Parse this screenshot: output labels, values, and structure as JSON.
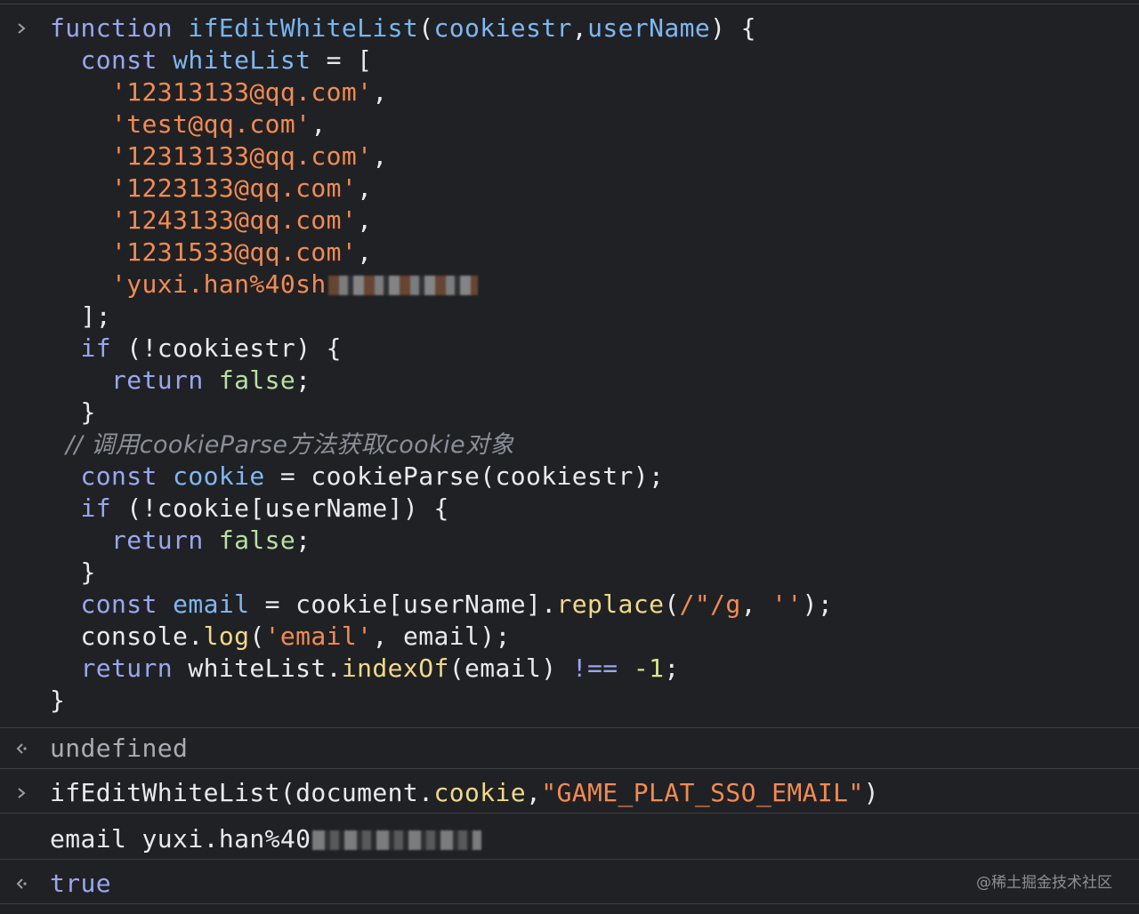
{
  "console": {
    "input1": {
      "lines": [
        [
          "function ",
          "ifEditWhiteList",
          "(",
          "cookiestr",
          ",",
          "userName",
          ") {"
        ],
        [
          "  const ",
          "whiteList",
          " = ["
        ],
        [
          "    ",
          "'12313133@qq.com'",
          ","
        ],
        [
          "    ",
          "'test@qq.com'",
          ","
        ],
        [
          "    ",
          "'12313133@qq.com'",
          ","
        ],
        [
          "    ",
          "'1223133@qq.com'",
          ","
        ],
        [
          "    ",
          "'1243133@qq.com'",
          ","
        ],
        [
          "    ",
          "'1231533@qq.com'",
          ","
        ],
        [
          "    ",
          "'yuxi.han%40sh"
        ],
        [
          "  ];"
        ],
        [
          "  if ",
          "(!cookiestr) {"
        ],
        [
          "    return ",
          "false",
          ";"
        ],
        [
          "  }"
        ],
        [
          "  // 调用cookieParse方法获取cookie对象"
        ],
        [
          "  const ",
          "cookie",
          " = ",
          "cookieParse(cookiestr);"
        ],
        [
          "  if ",
          "(!cookie[userName]) {"
        ],
        [
          "    return ",
          "false",
          ";"
        ],
        [
          "  }"
        ],
        [
          "  const ",
          "email",
          " = ",
          "cookie[userName].",
          "replace",
          "(",
          "/\"/g",
          ", ",
          "''",
          ");"
        ],
        [
          "  console.",
          "log",
          "(",
          "'email'",
          ", email);"
        ],
        [
          "  return ",
          "whiteList.",
          "indexOf",
          "(email) ",
          "!==",
          " ",
          "-1",
          ";"
        ],
        [
          "}"
        ]
      ]
    },
    "output1": "undefined",
    "input2": {
      "func": "ifEditWhiteList(document.",
      "prop": "cookie",
      "comma": ",",
      "arg": "\"GAME_PLAT_SSO_EMAIL\"",
      "close": ")"
    },
    "log": "email yuxi.han%40",
    "output2": "true"
  },
  "watermark": "@稀土掘金技术社区",
  "icons": {
    "input_prompt": "chevron-right-icon",
    "result_prompt": "return-arrow-icon"
  },
  "colors": {
    "background": "#202124",
    "keyword": "#9ba6f0",
    "identifier": "#7fb7f2",
    "string": "#f28b54",
    "boolean": "#b9e0a5",
    "method": "#f0d98a"
  }
}
